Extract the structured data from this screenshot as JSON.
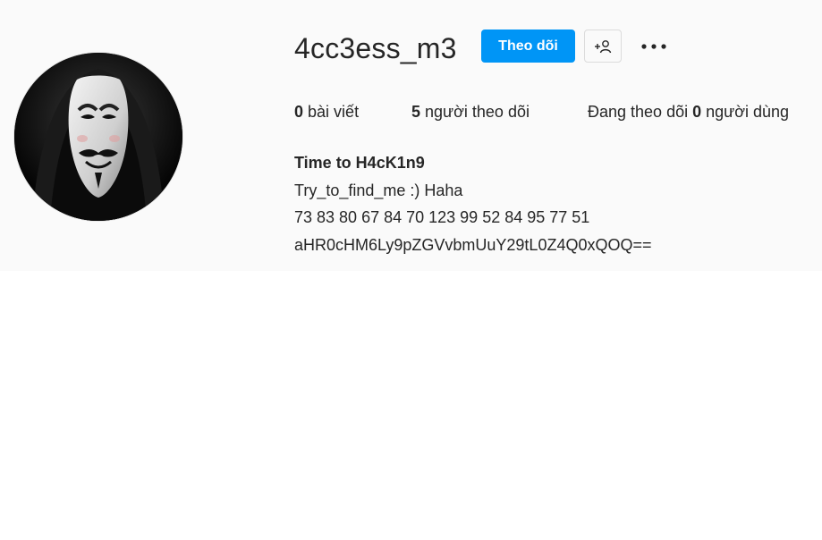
{
  "profile": {
    "username": "4cc3ess_m3",
    "follow_label": "Theo dõi",
    "avatar_alt": "Ảnh đại diện của 4cc3ess_m3",
    "stats": {
      "posts_count": "0",
      "posts_label": "bài viết",
      "followers_count": "5",
      "followers_label": "người theo dõi",
      "following_prefix": "Đang theo dõi",
      "following_count": "0",
      "following_suffix": "người dùng"
    },
    "bio": {
      "name": "Time to H4cK1n9",
      "line1": "Try_to_find_me :) Haha",
      "line2": "73 83 80 67 84 70 123 99 52 84 95 77 51",
      "line3": "aHR0cHM6Ly9pZGVvbmUuY29tL0Z4Q0xQOQ=="
    }
  },
  "icons": {
    "suggest": "add-person-icon",
    "more": "more-options-icon"
  },
  "colors": {
    "accent": "#0095f6",
    "header_bg": "#fafafa",
    "text": "#262626"
  }
}
